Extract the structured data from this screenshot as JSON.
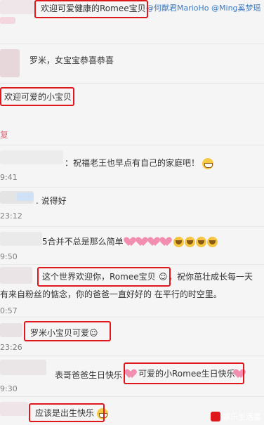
{
  "comments": [
    {
      "text": "欢迎可爱健康的Romee宝贝",
      "mention": "@何猷君MarioHo @Ming奚梦瑶"
    },
    {
      "text": "罗米，女宝宝恭喜恭喜"
    },
    {
      "text": "欢迎可爱的小宝贝"
    },
    {
      "text": "复"
    },
    {
      "text": "：祝福老王也早点有自己的家庭吧！",
      "time": "9:41"
    },
    {
      "text": ". 说得好",
      "time": "23:12"
    },
    {
      "text": "5合并不总是那么简单",
      "time": "9:50"
    },
    {
      "text": "这个世界欢迎你，Romee宝贝",
      "text_cont": "，祝你茁壮成长每一天",
      "line2": "有来自粉丝的惦念，你的爸爸一直好好的 在平行的时空里。",
      "time": "0:57"
    },
    {
      "text": "罗米小宝贝可爱",
      "time": "23:26"
    },
    {
      "text": "表哥爸爸生日快乐",
      "text2": "可爱的小Romee生日快乐",
      "time": "9:30"
    },
    {
      "text": "应该是出生快乐"
    }
  ],
  "watermark": "娱乐生活富"
}
